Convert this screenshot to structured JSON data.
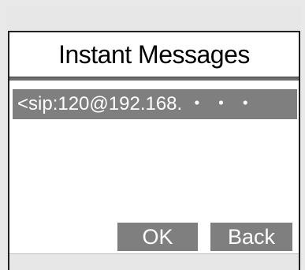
{
  "screen": {
    "title": "Instant Messages",
    "messages": [
      {
        "address": "<sip:120@192.168. ・ ・ ・"
      }
    ],
    "softkeys": {
      "ok_label": "OK",
      "back_label": "Back"
    }
  }
}
